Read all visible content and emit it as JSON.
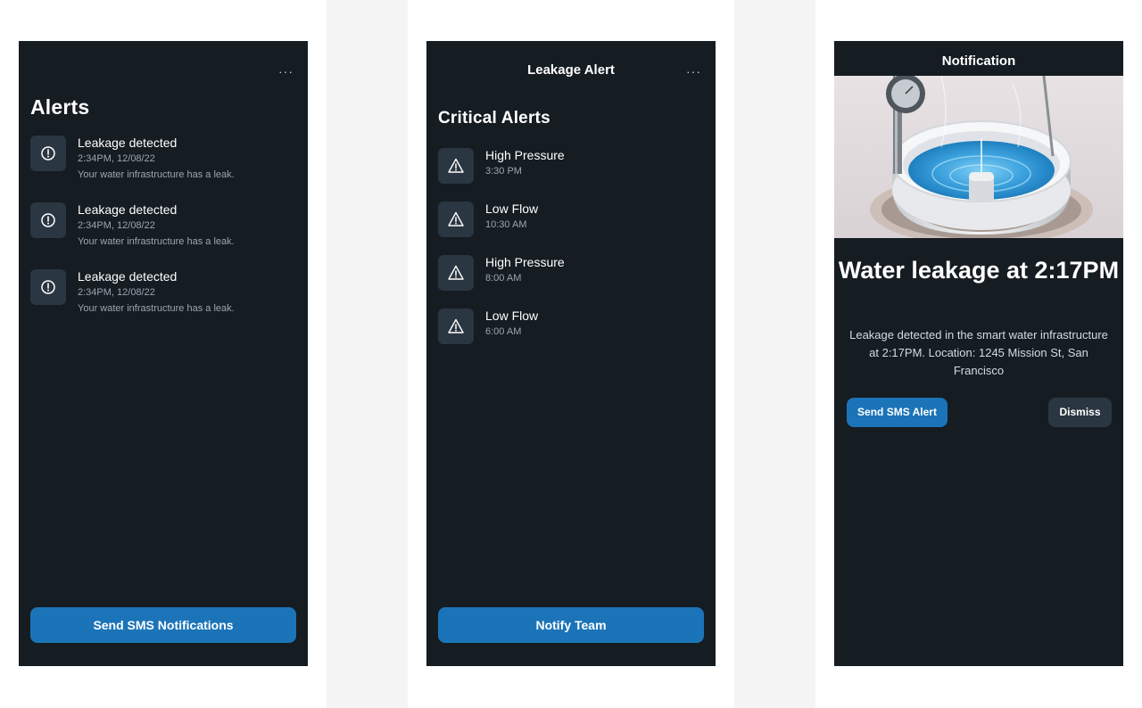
{
  "screens": {
    "alerts": {
      "title": "Alerts",
      "more": "···",
      "items": [
        {
          "title": "Leakage detected",
          "time": "2:34PM, 12/08/22",
          "description": "Your water infrastructure has a leak."
        },
        {
          "title": "Leakage detected",
          "time": "2:34PM, 12/08/22",
          "description": "Your water infrastructure has a leak."
        },
        {
          "title": "Leakage detected",
          "time": "2:34PM, 12/08/22",
          "description": "Your water infrastructure has a leak."
        }
      ],
      "button_label": "Send SMS Notifications"
    },
    "leakage_alert": {
      "title": "Leakage Alert",
      "more": "···",
      "heading": "Critical Alerts",
      "items": [
        {
          "title": "High Pressure",
          "time": "3:30 PM"
        },
        {
          "title": "Low Flow",
          "time": "10:30 AM"
        },
        {
          "title": "High Pressure",
          "time": "8:00 AM"
        },
        {
          "title": "Low Flow",
          "time": "6:00 AM"
        }
      ],
      "button_label": "Notify Team"
    },
    "notification": {
      "title": "Notification",
      "heading": "Water leakage at 2:17PM",
      "body": "Leakage detected in the smart water infrastructure at 2:17PM. Location: 1245 Mission St, San Francisco",
      "primary_button": "Send SMS Alert",
      "secondary_button": "Dismiss"
    }
  },
  "colors": {
    "screen_bg": "#151c22",
    "icon_bg": "#2a3641",
    "accent": "#1b74b8",
    "muted_text": "#9aa7b2"
  },
  "icons": {
    "alerts": "alert-circle-icon",
    "critical": "warning-triangle-icon",
    "menu": "more-horizontal-icon"
  }
}
